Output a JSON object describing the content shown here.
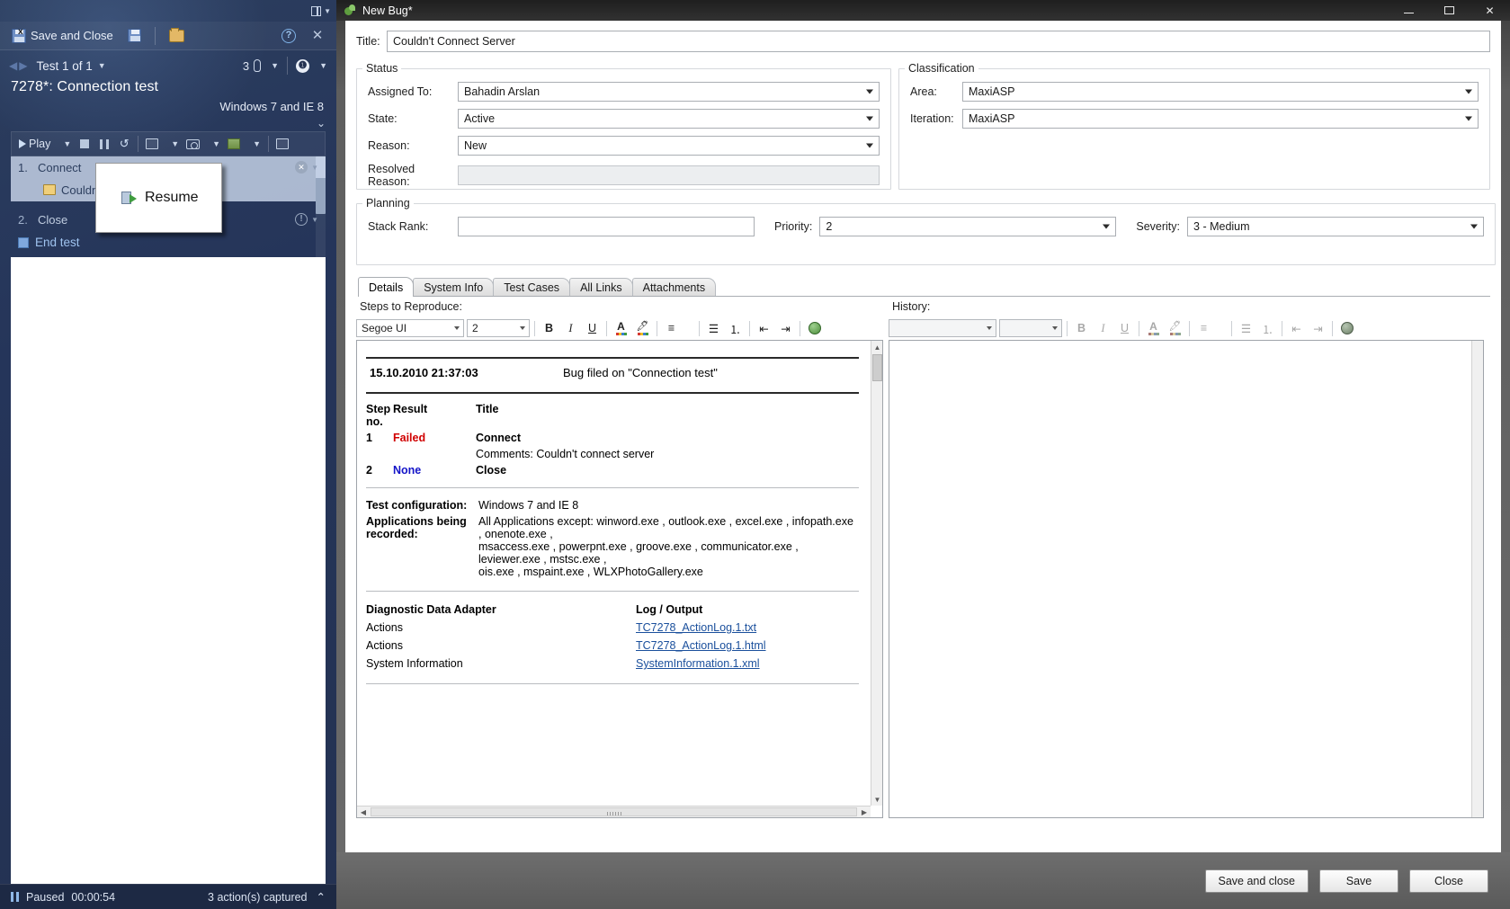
{
  "test_runner": {
    "toolbar": {
      "save_and_close": "Save and Close",
      "save_icon": "save-icon",
      "open_icon": "open-folder-icon",
      "help_icon": "help-icon",
      "close_icon": "close-icon",
      "dock_icon": "dock-layout-icon"
    },
    "nav": {
      "test_position": "Test 1 of 1",
      "attachment_count": "3",
      "attachment_icon": "paperclip-icon",
      "info_icon": "info-icon"
    },
    "test_id_title": "7278*: Connection test",
    "configuration": "Windows 7 and IE 8",
    "play_toolbar": {
      "play_label": "Play",
      "stop_icon": "stop-icon",
      "pause_icon": "pause-icon",
      "undo_icon": "undo-icon",
      "record_icon": "record-steps-icon",
      "screenshot_icon": "camera-icon",
      "chart_icon": "chart-icon",
      "comment_icon": "comment-icon"
    },
    "steps": [
      {
        "num": "1.",
        "text": "Connect",
        "selected": true,
        "status_icon": "fail-circle-icon"
      },
      {
        "num": "",
        "text": "Couldn'",
        "is_note": true,
        "note_icon": "note-icon"
      },
      {
        "num": "2.",
        "text": "Close",
        "selected": false,
        "status_icon": "info-circle-icon"
      }
    ],
    "end_test_label": "End test",
    "popup": {
      "label": "Resume",
      "icon": "resume-icon"
    },
    "status": {
      "state": "Paused",
      "elapsed": "00:00:54",
      "actions_captured": "3 action(s) captured",
      "pause_icon": "pause-icon",
      "expand_icon": "chevron-up-icon"
    }
  },
  "bug_window": {
    "title": "New Bug*",
    "app_icon": "bug-app-icon",
    "window_buttons": {
      "minimize": "minimize-icon",
      "maximize": "restore-icon",
      "close": "close-icon"
    },
    "title_field": {
      "label": "Title:",
      "value": "Couldn't Connect Server",
      "placeholder": ""
    },
    "status_group": {
      "legend": "Status",
      "fields": [
        {
          "label": "Assigned To:",
          "value": "Bahadin Arslan",
          "type": "combo"
        },
        {
          "label": "State:",
          "value": "Active",
          "type": "combo"
        },
        {
          "label": "Reason:",
          "value": "New",
          "type": "combo"
        },
        {
          "label": "Resolved Reason:",
          "value": "",
          "type": "readonly"
        }
      ]
    },
    "classification_group": {
      "legend": "Classification",
      "fields": [
        {
          "label": "Area:",
          "value": "MaxiASP",
          "type": "combo"
        },
        {
          "label": "Iteration:",
          "value": "MaxiASP",
          "type": "combo"
        }
      ]
    },
    "planning_group": {
      "legend": "Planning",
      "stack_rank": {
        "label": "Stack Rank:",
        "value": "",
        "placeholder": ""
      },
      "priority": {
        "label": "Priority:",
        "value": "2"
      },
      "severity": {
        "label": "Severity:",
        "value": "3 - Medium"
      }
    },
    "tabs": [
      {
        "label": "Details",
        "active": true
      },
      {
        "label": "System Info",
        "active": false
      },
      {
        "label": "Test Cases",
        "active": false
      },
      {
        "label": "All Links",
        "active": false
      },
      {
        "label": "Attachments",
        "active": false
      }
    ],
    "steps_panel_label": "Steps to Reproduce:",
    "history_panel_label": "History:",
    "rte_left": {
      "font_family": "Segoe UI",
      "font_size": "2",
      "bold": "B",
      "italic": "I",
      "underline": "U",
      "font_color_icon": "font-color-icon",
      "highlight_icon": "highlight-icon",
      "align_icon": "align-left-icon",
      "bullets_icon": "bullet-list-icon",
      "numbering_icon": "numbered-list-icon",
      "outdent_icon": "decrease-indent-icon",
      "indent_icon": "increase-indent-icon",
      "link_icon": "hyperlink-icon"
    },
    "rte_right": {
      "font_family": "",
      "font_size": "",
      "bold": "B",
      "italic": "I",
      "underline": "U",
      "font_color_icon": "font-color-icon",
      "highlight_icon": "highlight-icon",
      "align_icon": "align-left-icon",
      "bullets_icon": "bullet-list-icon",
      "numbering_icon": "numbered-list-icon",
      "outdent_icon": "decrease-indent-icon",
      "indent_icon": "increase-indent-icon",
      "link_icon": "hyperlink-icon"
    },
    "steps_document": {
      "filed_date": "15.10.2010 21:37:03",
      "filed_on": "Bug filed on \"Connection test\"",
      "table_headers": {
        "step": "Step no.",
        "step_line1": "Step",
        "step_line2": "no.",
        "result": "Result",
        "title": "Title"
      },
      "steps": [
        {
          "no": "1",
          "result": "Failed",
          "result_color": "#d00000",
          "title": "Connect",
          "comment": "Comments: Couldn't connect server"
        },
        {
          "no": "2",
          "result": "None",
          "result_color": "#1414c8",
          "title": "Close",
          "comment": ""
        }
      ],
      "test_configuration_label": "Test configuration:",
      "test_configuration_value": "Windows 7 and IE 8",
      "applications_label_line1": "Applications being",
      "applications_label_line2": "recorded:",
      "applications_value_line1": "All Applications except: winword.exe , outlook.exe , excel.exe , infopath.exe , onenote.exe ,",
      "applications_value_line2": "msaccess.exe , powerpnt.exe , groove.exe , communicator.exe , leviewer.exe , mstsc.exe ,",
      "applications_value_line3": "ois.exe , mspaint.exe , WLXPhotoGallery.exe",
      "adapter_header_left": "Diagnostic Data Adapter",
      "adapter_header_right": "Log / Output",
      "adapter_rows": [
        {
          "adapter": "Actions",
          "log": "TC7278_ActionLog.1.txt"
        },
        {
          "adapter": "Actions",
          "log": "TC7278_ActionLog.1.html"
        },
        {
          "adapter": "System Information",
          "log": "SystemInformation.1.xml"
        }
      ]
    },
    "history_content": "",
    "footer_buttons": [
      {
        "label": "Save and close"
      },
      {
        "label": "Save"
      },
      {
        "label": "Close"
      }
    ]
  },
  "colors": {
    "runner_bg": "#253254",
    "accent_link": "#1a4f9c",
    "fail": "#d00000",
    "none": "#1414c8",
    "tab_active": "#ffffff"
  }
}
